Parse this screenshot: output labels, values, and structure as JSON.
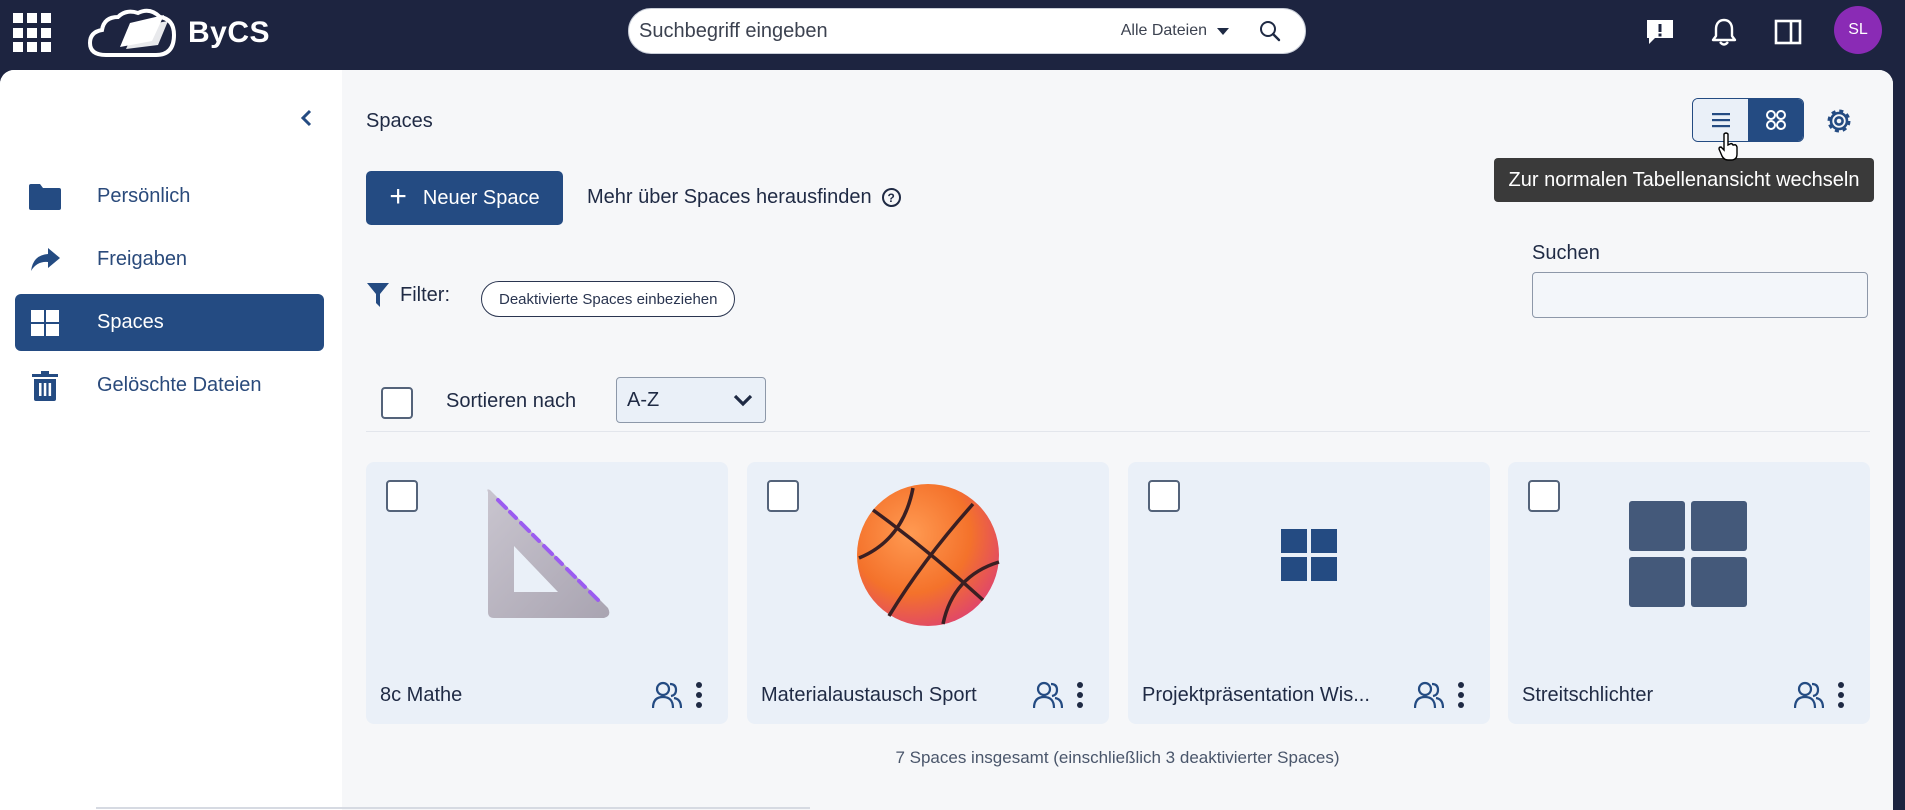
{
  "topbar": {
    "logo_text": "ByCS",
    "search_placeholder": "Suchbegriff eingeben",
    "search_scope": "Alle Dateien",
    "avatar_initials": "SL",
    "avatar_color": "#8a2bb5"
  },
  "sidebar": {
    "items": [
      {
        "label": "Persönlich",
        "icon": "folder-icon",
        "active": false
      },
      {
        "label": "Freigaben",
        "icon": "share-icon",
        "active": false
      },
      {
        "label": "Spaces",
        "icon": "spaces-grid-icon",
        "active": true
      },
      {
        "label": "Gelöschte Dateien",
        "icon": "trash-icon",
        "active": false
      }
    ]
  },
  "main": {
    "breadcrumb": "Spaces",
    "tooltip": "Zur normalen Tabellenansicht wechseln",
    "new_space_label": "Neuer Space",
    "learn_more_label": "Mehr über Spaces herausfinden",
    "search_label": "Suchen",
    "filter_label": "Filter:",
    "filter_chip": "Deaktivierte Spaces einbeziehen",
    "sort_label": "Sortieren nach",
    "sort_value": "A-Z",
    "spaces": [
      {
        "name": "8c Mathe",
        "image": "set-square-icon"
      },
      {
        "name": "Materialaustausch Sport",
        "image": "basketball-icon"
      },
      {
        "name": "Projektpräsentation Wis...",
        "image": "spaces-grid-icon"
      },
      {
        "name": "Streitschlichter",
        "image": "spaces-grid-icon"
      }
    ],
    "footer": "7 Spaces insgesamt (einschließlich 3 deaktivierter Spaces)"
  },
  "colors": {
    "primary": "#244b82",
    "topbar": "#1d2440",
    "card_bg": "#eaf0f8"
  }
}
